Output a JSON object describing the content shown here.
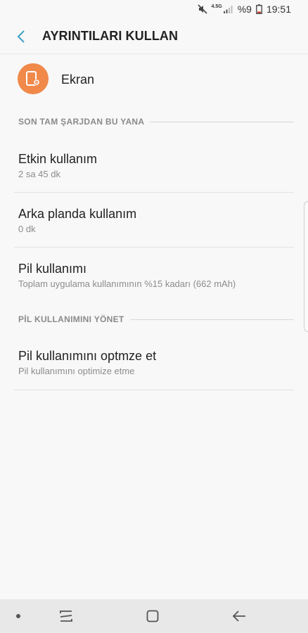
{
  "status": {
    "network": "4.5G",
    "battery": "%9",
    "time": "19:51"
  },
  "header": {
    "title": "AYRINTILARI KULLAN"
  },
  "app": {
    "name": "Ekran",
    "icon": "display-settings-icon",
    "icon_color": "#f0894a"
  },
  "sections": [
    {
      "label": "SON TAM ŞARJDAN BU YANA"
    },
    {
      "label": "PİL KULLANIMINI YÖNET"
    }
  ],
  "usage": [
    {
      "title": "Etkin kullanım",
      "subtitle": "2 sa 45 dk"
    },
    {
      "title": "Arka planda kullanım",
      "subtitle": "0 dk"
    },
    {
      "title": "Pil kullanımı",
      "subtitle": "Toplam uygulama kullanımının %15 kadarı (662 mAh)"
    }
  ],
  "manage": [
    {
      "title": "Pil kullanımını optmze et",
      "subtitle": "Pil kullanımını optimize etme"
    }
  ],
  "colors": {
    "accent": "#3ea0c7",
    "background": "#f8f8f8"
  }
}
